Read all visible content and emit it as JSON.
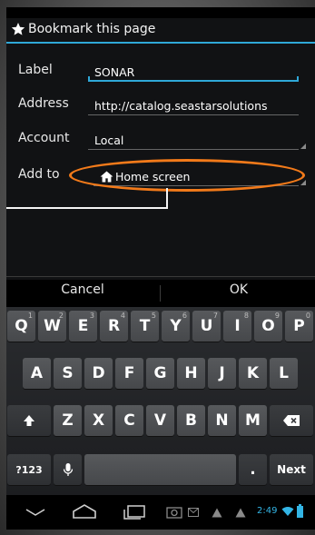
{
  "dialog": {
    "title": "Bookmark this page",
    "fields": [
      {
        "label": "Label",
        "value": "SONAR"
      },
      {
        "label": "Address",
        "value": "http://catalog.seastarsolutions"
      },
      {
        "label": "Account",
        "value": "Local"
      },
      {
        "label": "Add to",
        "value": "Home screen"
      }
    ],
    "cancel_label": "Cancel",
    "ok_label": "OK"
  },
  "keyboard": {
    "row1": [
      {
        "key": "Q",
        "hint": "1"
      },
      {
        "key": "W",
        "hint": "2"
      },
      {
        "key": "E",
        "hint": "3"
      },
      {
        "key": "R",
        "hint": "4"
      },
      {
        "key": "T",
        "hint": "5"
      },
      {
        "key": "Y",
        "hint": "6"
      },
      {
        "key": "U",
        "hint": "7"
      },
      {
        "key": "I",
        "hint": "8"
      },
      {
        "key": "O",
        "hint": "9"
      },
      {
        "key": "P",
        "hint": "0"
      }
    ],
    "row2": [
      "A",
      "S",
      "D",
      "F",
      "G",
      "H",
      "J",
      "K",
      "L"
    ],
    "row3": [
      "Z",
      "X",
      "C",
      "V",
      "B",
      "N",
      "M"
    ],
    "symbols_label": "?123",
    "period_label": ".",
    "next_label": "Next"
  },
  "status": {
    "time": "2:49"
  },
  "colors": {
    "accent_blue": "#2fa8d8",
    "highlight_orange": "#f27a1a"
  }
}
